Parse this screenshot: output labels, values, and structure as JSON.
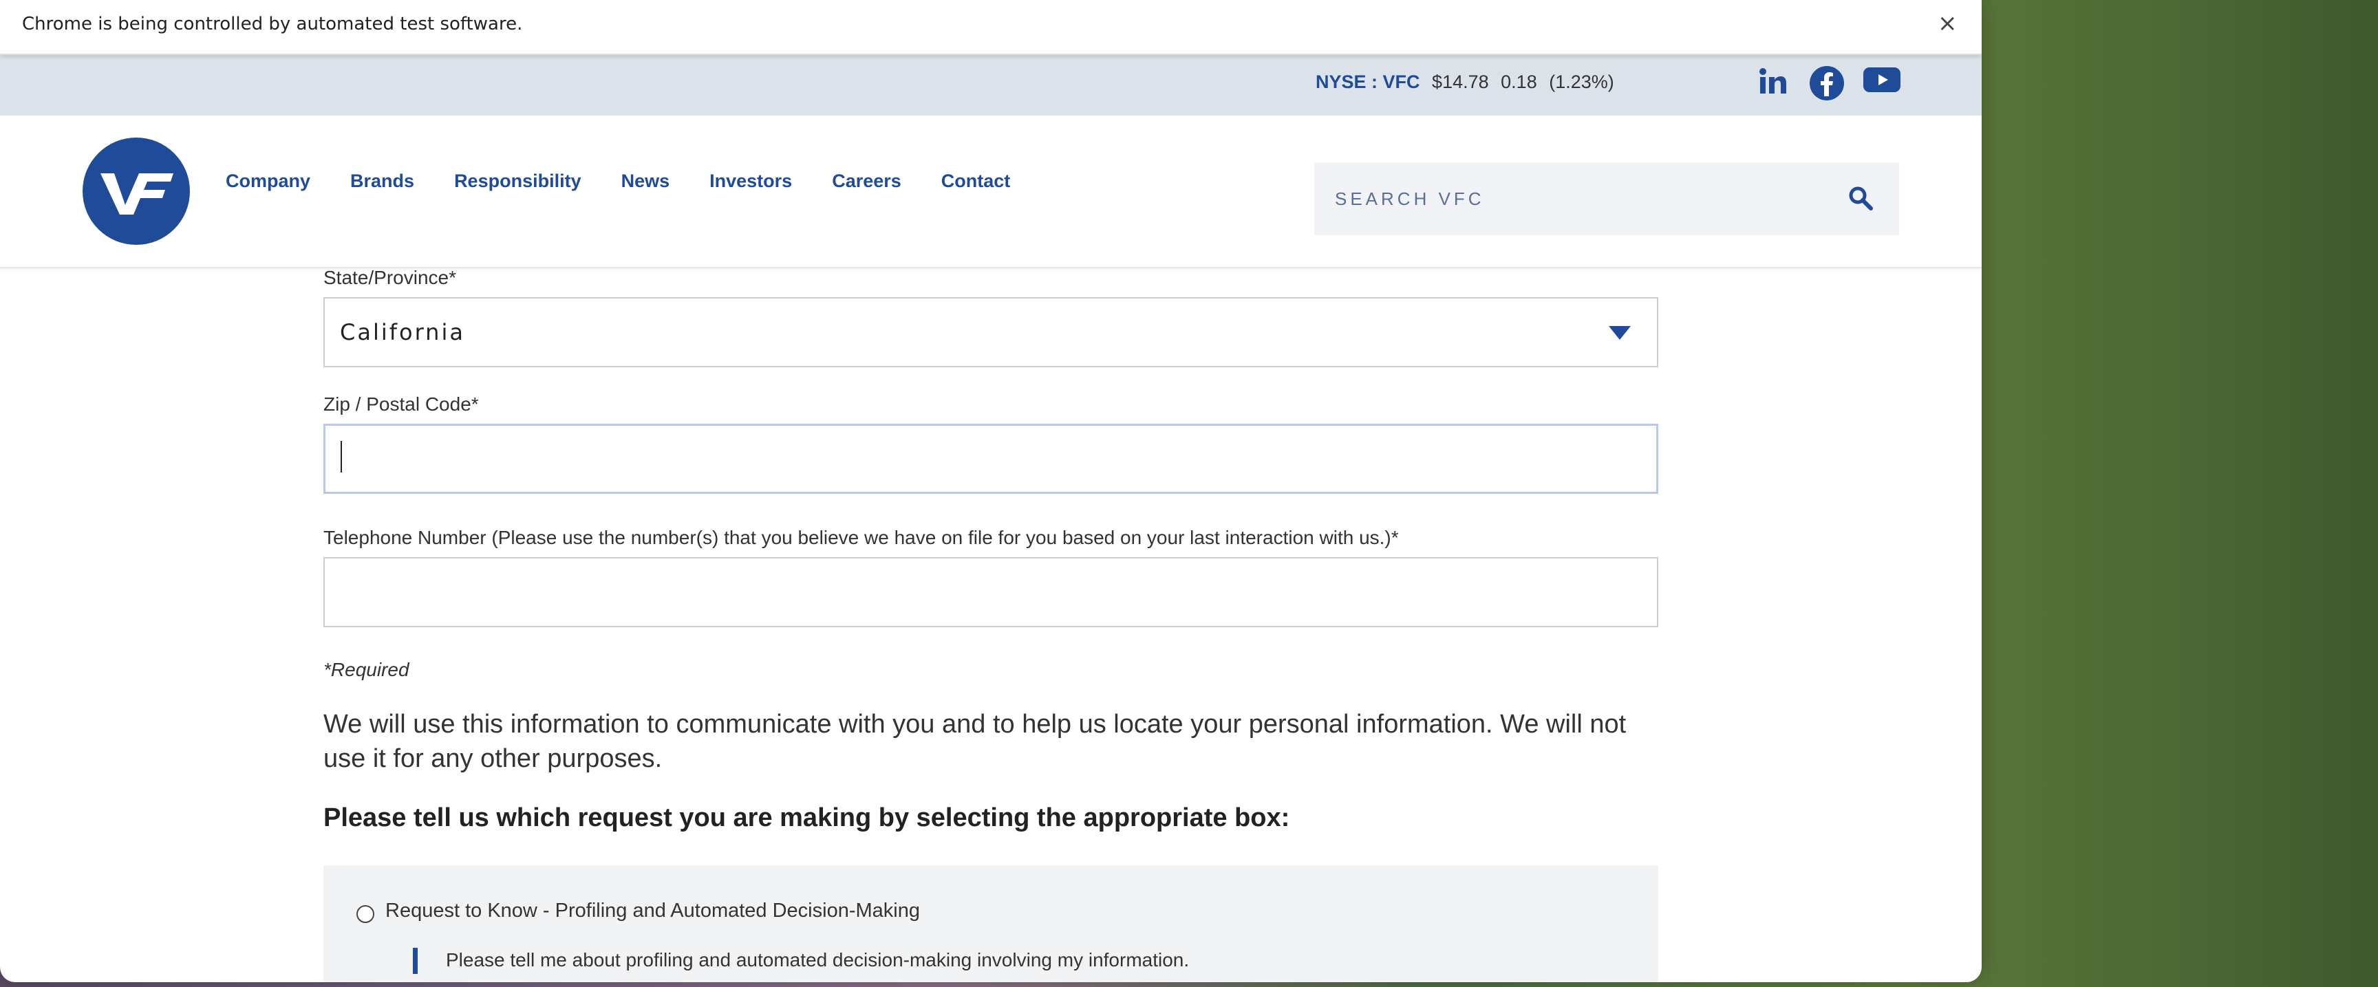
{
  "browser": {
    "info_bar_message": "Chrome is being controlled by automated test software.",
    "close_glyph": "×"
  },
  "topbar": {
    "ticker_symbol": "NYSE : VFC",
    "ticker_price": "$14.78",
    "ticker_change": "0.18",
    "ticker_percent": "(1.23%)",
    "social": [
      "linkedin-icon",
      "facebook-icon",
      "youtube-icon"
    ],
    "brand_color": "#1f4b99"
  },
  "header": {
    "nav": [
      "Company",
      "Brands",
      "Responsibility",
      "News",
      "Investors",
      "Careers",
      "Contact"
    ],
    "search_placeholder": "SEARCH VFC"
  },
  "form": {
    "state_label": "State/Province*",
    "state_value": "California",
    "zip_label": "Zip / Postal Code*",
    "zip_value": "",
    "phone_label": "Telephone Number (Please use the number(s) that you believe we have on file for you based on your last interaction with us.)*",
    "phone_value": "",
    "required_note": "*Required",
    "info_text": "We will use this information to communicate with you and to help us locate your personal information. We will not use it for any other purposes.",
    "question": "Please tell us which request you are making by selecting the appropriate box:",
    "options": [
      {
        "label": "Request to Know - Profiling and Automated Decision-Making",
        "description": "Please tell me about profiling and automated decision-making involving my information."
      }
    ]
  }
}
